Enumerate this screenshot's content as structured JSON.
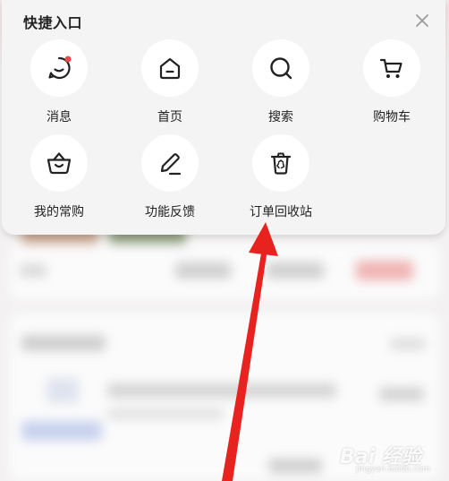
{
  "quick_entry": {
    "title": "快捷入口",
    "items": [
      {
        "label": "消息",
        "icon": "message-icon"
      },
      {
        "label": "首页",
        "icon": "home-icon"
      },
      {
        "label": "搜索",
        "icon": "search-icon"
      },
      {
        "label": "购物车",
        "icon": "cart-icon"
      },
      {
        "label": "我的常购",
        "icon": "basket-icon"
      },
      {
        "label": "功能反馈",
        "icon": "pen-icon"
      },
      {
        "label": "订单回收站",
        "icon": "trash-icon"
      }
    ]
  },
  "colors": {
    "notification_dot": "#f04848",
    "annotation_arrow": "#e8231f",
    "panel_bg": "#f5f4f4"
  },
  "watermark": {
    "text": "Bai 经验",
    "url": "jingyan.baidu.com"
  }
}
